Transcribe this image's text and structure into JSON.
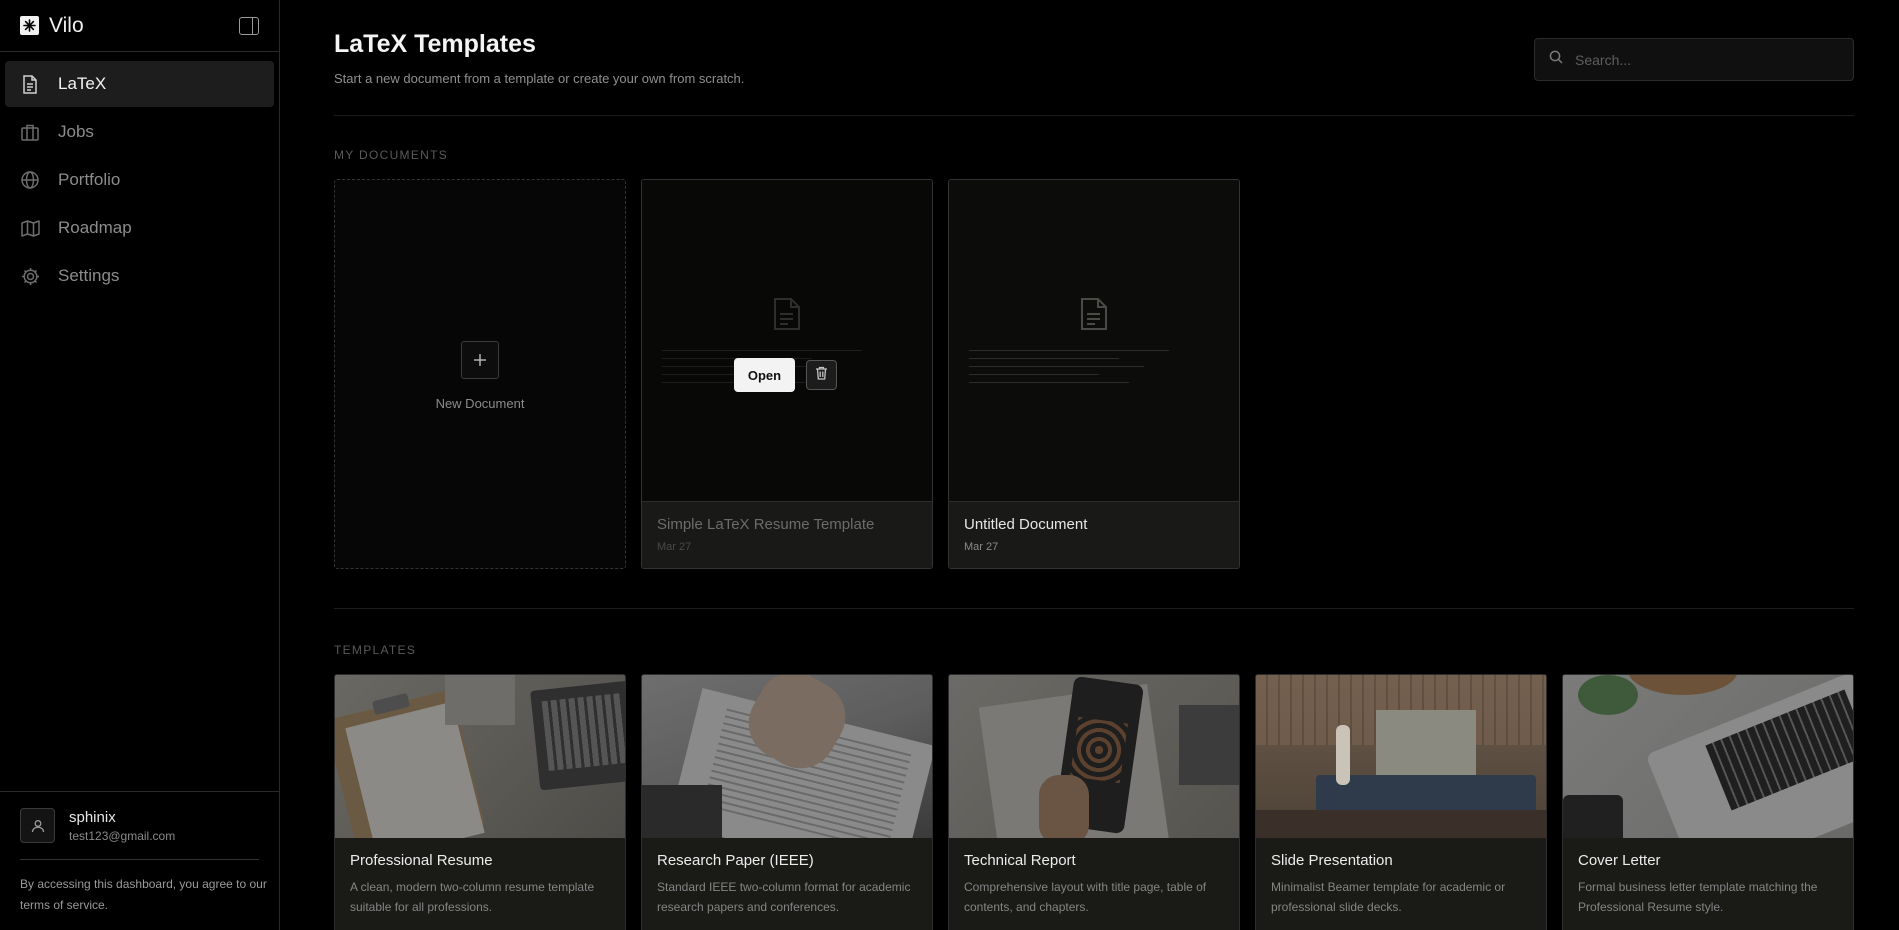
{
  "app": {
    "name": "Vilo"
  },
  "sidebar": {
    "items": [
      {
        "label": "LaTeX",
        "icon": "document-icon",
        "active": true
      },
      {
        "label": "Jobs",
        "icon": "briefcase-icon",
        "active": false
      },
      {
        "label": "Portfolio",
        "icon": "globe-icon",
        "active": false
      },
      {
        "label": "Roadmap",
        "icon": "map-icon",
        "active": false
      },
      {
        "label": "Settings",
        "icon": "gear-icon",
        "active": false
      }
    ],
    "user": {
      "name": "sphinix",
      "email": "test123@gmail.com"
    },
    "terms": "By accessing this dashboard, you agree to our terms of service."
  },
  "header": {
    "title": "LaTeX Templates",
    "subtitle": "Start a new document from a template or create your own from scratch.",
    "search_placeholder": "Search..."
  },
  "my_documents": {
    "label": "MY DOCUMENTS",
    "new_label": "New Document",
    "docs": [
      {
        "title": "Simple LaTeX Resume Template",
        "date": "Mar 27",
        "open_label": "Open"
      },
      {
        "title": "Untitled Document",
        "date": "Mar 27"
      }
    ]
  },
  "templates": {
    "label": "TEMPLATES",
    "items": [
      {
        "title": "Professional Resume",
        "desc": "A clean, modern two-column resume template suitable for all professions."
      },
      {
        "title": "Research Paper (IEEE)",
        "desc": "Standard IEEE two-column format for academic research papers and conferences."
      },
      {
        "title": "Technical Report",
        "desc": "Comprehensive layout with title page, table of contents, and chapters."
      },
      {
        "title": "Slide Presentation",
        "desc": "Minimalist Beamer template for academic or professional slide decks."
      },
      {
        "title": "Cover Letter",
        "desc": "Formal business letter template matching the Professional Resume style."
      }
    ]
  },
  "colors": {
    "background": "#000000",
    "card": "#191917",
    "accent": "#f3f3f3"
  }
}
